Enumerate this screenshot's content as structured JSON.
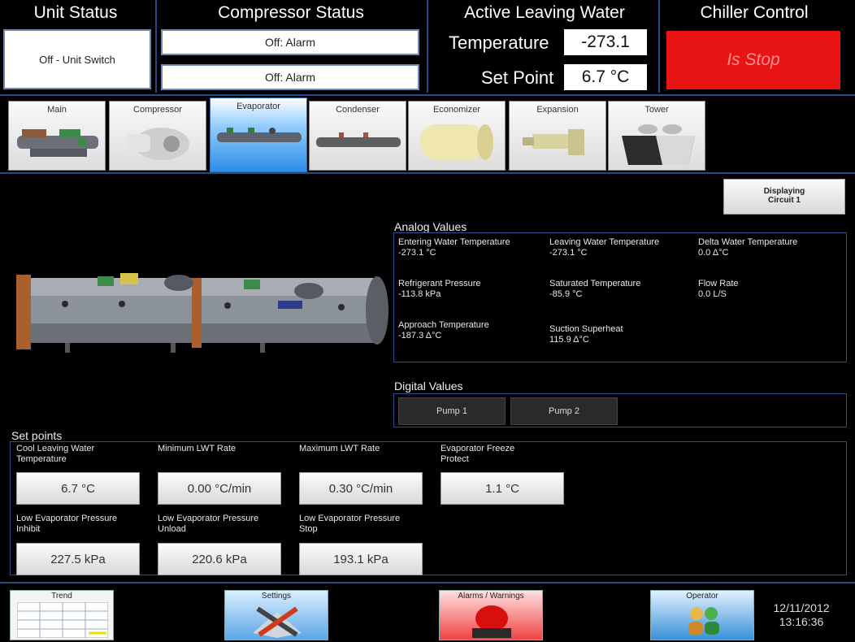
{
  "header": {
    "unit_status_title": "Unit Status",
    "unit_status_value": "Off - Unit Switch",
    "compressor_status_title": "Compressor Status",
    "compressor_status_1": "Off: Alarm",
    "compressor_status_2": "Off: Alarm",
    "alw_title": "Active Leaving Water",
    "temperature_label": "Temperature",
    "temperature_value": "-273.1",
    "setpoint_label": "Set Point",
    "setpoint_value": "6.7 °C",
    "chiller_control_title": "Chiller Control",
    "chiller_control_button": "Is Stop"
  },
  "tabs": [
    {
      "label": "Main",
      "active": false
    },
    {
      "label": "Compressor",
      "active": false
    },
    {
      "label": "Evaporator",
      "active": true
    },
    {
      "label": "Condenser",
      "active": false
    },
    {
      "label": "Economizer",
      "active": false
    },
    {
      "label": "Expansion",
      "active": false
    },
    {
      "label": "Tower",
      "active": false
    }
  ],
  "display_circuit": {
    "line1": "Displaying",
    "line2": "Circuit 1"
  },
  "analog": {
    "title": "Analog Values",
    "items": [
      {
        "label": "Entering Water Temperature",
        "value": "-273.1 °C"
      },
      {
        "label": "Leaving Water Temperature",
        "value": "-273.1 °C"
      },
      {
        "label": "Delta Water Temperature",
        "value": "0.0 Δ°C"
      },
      {
        "label": "Refrigerant Pressure",
        "value": "-113.8 kPa"
      },
      {
        "label": "Saturated Temperature",
        "value": "-85.9 °C"
      },
      {
        "label": "Flow Rate",
        "value": "0.0 L/S"
      },
      {
        "label": "Approach Temperature",
        "value": "-187.3 Δ°C"
      },
      {
        "label": "Suction Superheat",
        "value": "115.9 Δ°C"
      }
    ]
  },
  "digital": {
    "title": "Digital Values",
    "pump1": "Pump 1",
    "pump2": "Pump 2"
  },
  "setpoints": {
    "title": "Set points",
    "items": [
      {
        "label1": "Cool Leaving Water",
        "label2": "Temperature",
        "value": "6.7 °C"
      },
      {
        "label1": "",
        "label2": "Minimum LWT Rate",
        "value": "0.00 °C/min"
      },
      {
        "label1": "",
        "label2": "Maximum LWT Rate",
        "value": "0.30 °C/min"
      },
      {
        "label1": "Evaporator Freeze",
        "label2": "Protect",
        "value": "1.1 °C"
      },
      {
        "label1": "Low Evaporator Pressure",
        "label2": "Inhibit",
        "value": "227.5 kPa"
      },
      {
        "label1": "Low Evaporator Pressure",
        "label2": "Unload",
        "value": "220.6 kPa"
      },
      {
        "label1": "Low Evaporator Pressure",
        "label2": "Stop",
        "value": "193.1 kPa"
      }
    ]
  },
  "footer": {
    "trend": "Trend",
    "settings": "Settings",
    "alarms": "Alarms / Warnings",
    "operator": "Operator",
    "date": "12/11/2012",
    "time": "13:16:36"
  },
  "colors": {
    "stop_red": "#e81414",
    "panel_border": "#2c4f8a",
    "active_tab_blue": "#2d8de6"
  }
}
